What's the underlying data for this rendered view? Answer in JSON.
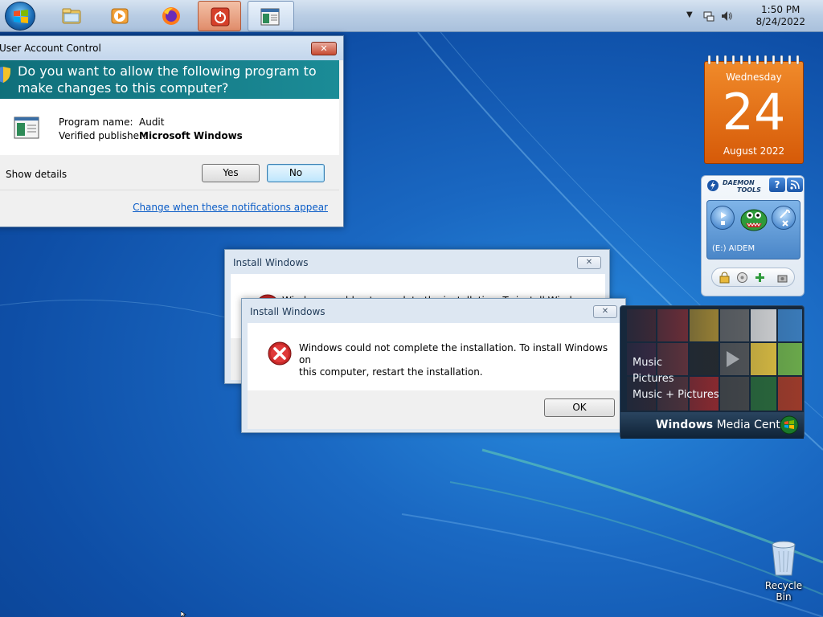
{
  "taskbar": {
    "items": [
      {
        "name": "file-explorer",
        "active": false
      },
      {
        "name": "media-player",
        "active": false
      },
      {
        "name": "firefox",
        "active": false
      },
      {
        "name": "power",
        "active": true
      },
      {
        "name": "audit-program",
        "active": true
      }
    ],
    "clock": {
      "time": "1:50 PM",
      "date": "8/24/2022"
    }
  },
  "uac": {
    "title": "User Account Control",
    "question": "Do you want to allow the following program to make changes to this computer?",
    "program_name_label": "Program name:",
    "program_name_value": "Audit",
    "publisher_label": "Verified publisher:",
    "publisher_value": "Microsoft Windows",
    "show_details": "Show details",
    "yes_label": "Yes",
    "no_label": "No",
    "link": "Change when these notifications appear"
  },
  "install_back": {
    "title": "Install Windows",
    "message": "Windows could not complete the installation. To install Windows on this computer, restart the installation."
  },
  "install_front": {
    "title": "Install Windows",
    "message_line1": "Windows could not complete the installation. To install Windows on",
    "message_line2": "this computer, restart the installation.",
    "ok_label": "OK"
  },
  "calendar": {
    "weekday": "Wednesday",
    "day": "24",
    "month_year": "August 2022"
  },
  "daemon_tools": {
    "brand_line1": "DAEMON",
    "brand_line2": "TOOLS",
    "help": "?",
    "drive": "(E:) AIDEM"
  },
  "media_center": {
    "items": [
      "Music",
      "Pictures",
      "Music + Pictures"
    ],
    "title_bold": "Windows",
    "title_rest": " Media Center"
  },
  "desktop": {
    "recycle_bin": "Recycle Bin"
  },
  "colors": {
    "uac_banner": "#177f8b",
    "calendar": "#e9731a",
    "link": "#0a5cc7"
  }
}
